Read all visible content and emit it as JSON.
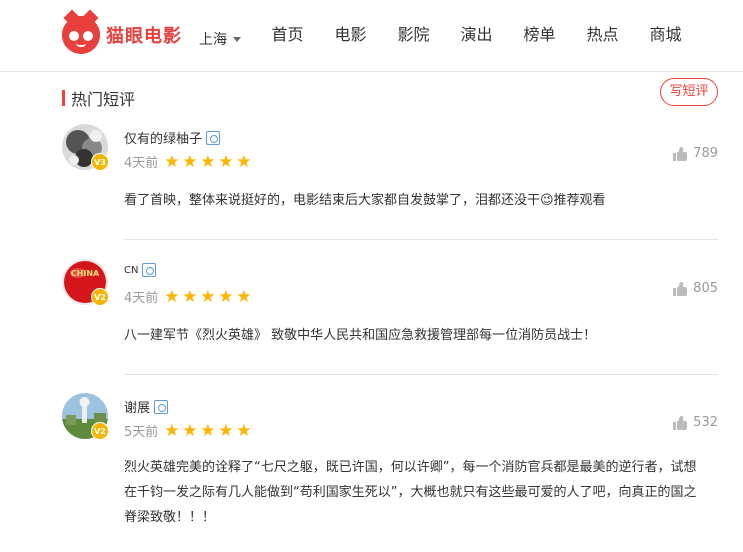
{
  "brand": {
    "name": "猫眼电影",
    "color": "#e8403c"
  },
  "header": {
    "city": "上海",
    "nav": [
      "首页",
      "电影",
      "影院",
      "演出",
      "榜单",
      "热点",
      "商城"
    ]
  },
  "section": {
    "title": "热门短评",
    "write_button": "写短评"
  },
  "comments": [
    {
      "username": "仅有的绿柚子",
      "level": "V3",
      "time": "4天前",
      "rating": 5,
      "likes": "789",
      "content": [
        "看了首映，整体来说挺好的，电影结束后大家都自发鼓掌了，泪都还没干😉推荐观看"
      ]
    },
    {
      "username": "CN",
      "level": "V2",
      "time": "4天前",
      "rating": 5,
      "likes": "805",
      "avatar_text": "CHINA",
      "content": [
        "八一建军节《烈火英雄》 致敬中华人民共和国应急救援管理部每一位消防员战士！"
      ]
    },
    {
      "username": "谢展",
      "level": "V2",
      "time": "5天前",
      "rating": 5,
      "likes": "532",
      "content": [
        "烈火英雄完美的诠释了“七尺之躯，既已许国，何以许卿”，每一个消防官兵都是最美的逆行者，试想",
        "在千钧一发之际有几人能做到“苟利国家生死以”，大概也就只有这些最可爱的人了吧，向真正的国之",
        "脊梁致敬！！！"
      ]
    }
  ],
  "colors": {
    "accent": "#ef4238",
    "star": "#ffb400",
    "badge": "#f7b500"
  },
  "icons": {
    "vip": "vip-badge-icon",
    "like": "thumbs-up-icon",
    "caret": "chevron-down-icon",
    "star": "star-icon"
  }
}
